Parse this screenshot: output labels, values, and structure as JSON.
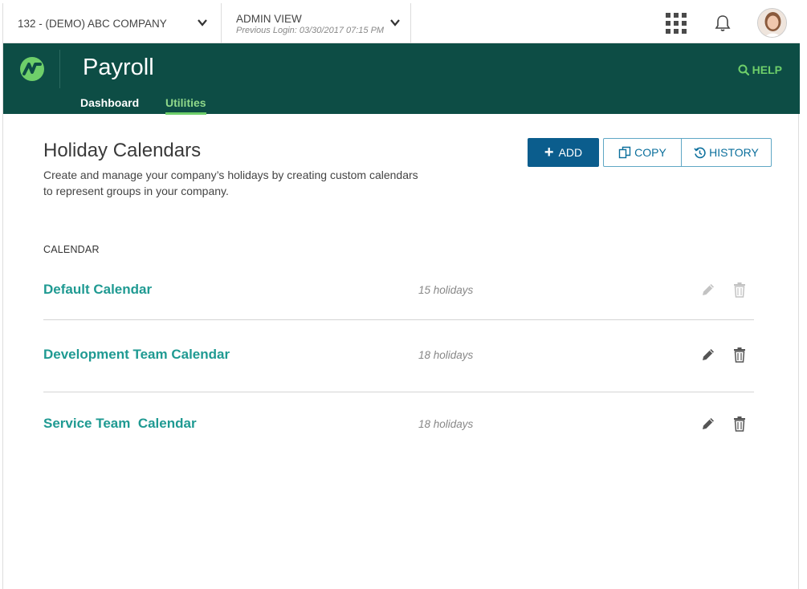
{
  "topbar": {
    "company": "132 - (DEMO) ABC COMPANY",
    "view_title": "ADMIN VIEW",
    "previous_login": "Previous Login: 03/30/2017 07:15 PM"
  },
  "header": {
    "app_title": "Payroll",
    "help_label": "HELP",
    "tabs": [
      {
        "label": "Dashboard"
      },
      {
        "label": "Utilities"
      }
    ]
  },
  "page": {
    "title": "Holiday Calendars",
    "description": "Create and manage your company’s holidays by creating custom calendars to represent groups in your company.",
    "add_label": "ADD",
    "copy_label": "COPY",
    "history_label": "HISTORY",
    "column_header": "CALENDAR"
  },
  "calendars": [
    {
      "name": "Default Calendar",
      "count": "15 holidays"
    },
    {
      "name": "Development Team Calendar",
      "count": "18 holidays"
    },
    {
      "name": "Service Team  Calendar",
      "count": "18 holidays"
    }
  ],
  "colors": {
    "header_bg": "#0d4d45",
    "accent_green": "#6ecf6a",
    "link_teal": "#1f9a92",
    "primary_button": "#0b5d8d"
  }
}
